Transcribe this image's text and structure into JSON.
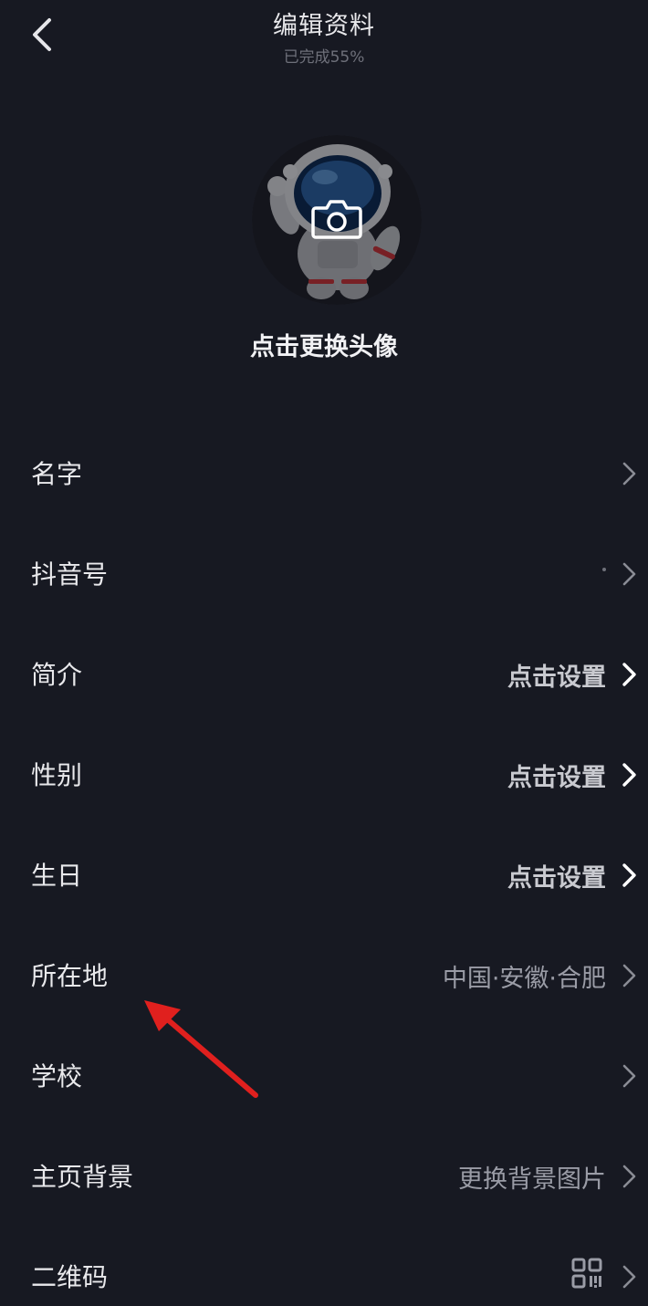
{
  "header": {
    "title": "编辑资料",
    "subtitle": "已完成55%"
  },
  "avatar": {
    "caption": "点击更换头像"
  },
  "rows": [
    {
      "label": "名字",
      "value": ""
    },
    {
      "label": "抖音号",
      "value": ""
    },
    {
      "label": "简介",
      "value": "点击设置"
    },
    {
      "label": "性别",
      "value": "点击设置"
    },
    {
      "label": "生日",
      "value": "点击设置"
    },
    {
      "label": "所在地",
      "value": "中国·安徽·合肥"
    },
    {
      "label": "学校",
      "value": ""
    },
    {
      "label": "主页背景",
      "value": "更换背景图片"
    },
    {
      "label": "二维码",
      "value": ""
    }
  ],
  "icons": {
    "back": "chevron-left-icon",
    "camera": "camera-icon",
    "chevron": "chevron-right-icon",
    "qr": "qr-code-icon",
    "annotation": "red-arrow-annotation"
  },
  "colors": {
    "background": "#171922",
    "annotation_red": "#e0201e"
  }
}
